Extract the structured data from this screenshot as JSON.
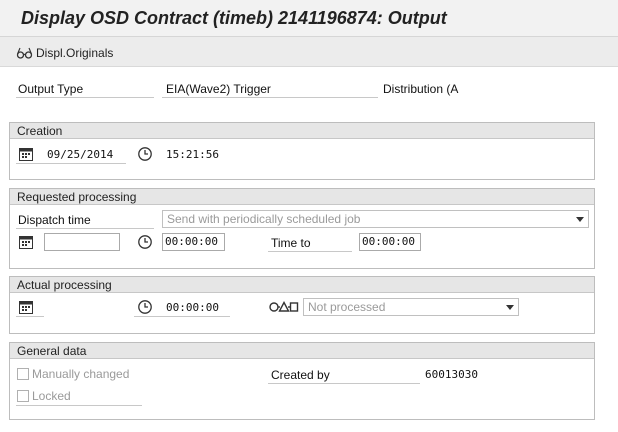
{
  "window": {
    "title": "Display OSD Contract (timeb) 2141196874: Output"
  },
  "toolbar": {
    "originals_label": "Displ.Originals",
    "originals_icon": "glasses-icon"
  },
  "header": {
    "output_type_label": "Output Type",
    "output_type_value": "EIA(Wave2) Trigger",
    "distribution_label": "Distribution (A"
  },
  "creation": {
    "title": "Creation",
    "date": "09/25/2014",
    "time": "15:21:56"
  },
  "requested": {
    "title": "Requested processing",
    "dispatch_label": "Dispatch time",
    "dispatch_value": "Send with periodically scheduled job",
    "date_value": "",
    "time_value": "00:00:00",
    "time_to_label": "Time to",
    "time_to_value": "00:00:00"
  },
  "actual": {
    "title": "Actual processing",
    "time": "00:00:00",
    "status_value": "Not processed"
  },
  "general": {
    "title": "General data",
    "manually_changed_label": "Manually changed",
    "manually_changed_checked": false,
    "locked_label": "Locked",
    "locked_checked": false,
    "created_by_label": "Created by",
    "created_by_value": "60013030"
  }
}
